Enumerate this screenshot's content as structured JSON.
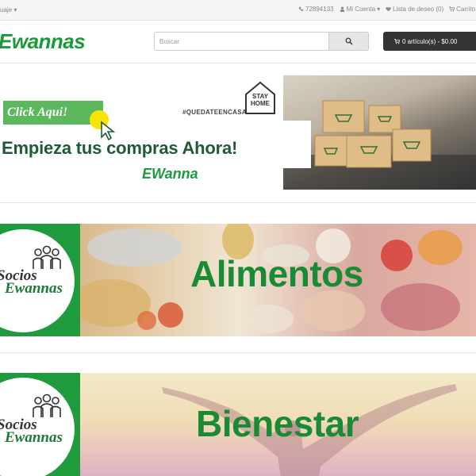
{
  "topbar": {
    "language_label": "uaje",
    "phone": "72894133",
    "account_label": "Mi Cuenta",
    "wishlist_label": "Lista de deseo (0)",
    "cart_link_label": "Carrito de"
  },
  "header": {
    "logo_text": "Ewannas",
    "search_placeholder": "Buscar",
    "cart_button_label": "0 artículo(s) - $0.00"
  },
  "banners": {
    "promo": {
      "click_label": "Click Aqui!",
      "hashtag": "#QUEDATEENCASA",
      "stay_home_label": "STAY HOME",
      "headline": "Empieza tus compras Ahora!",
      "brand_label": "EWanna"
    },
    "alimentos": {
      "badge_line1": "Socios",
      "badge_line2": "Ewannas",
      "title": "Alimentos"
    },
    "bienestar": {
      "badge_line1": "Socios",
      "badge_line2": "Ewannas",
      "title": "Bienestar"
    }
  },
  "colors": {
    "brand_green": "#1a9a3a",
    "dark_cart": "#343434",
    "button_green": "#5cb85c"
  }
}
